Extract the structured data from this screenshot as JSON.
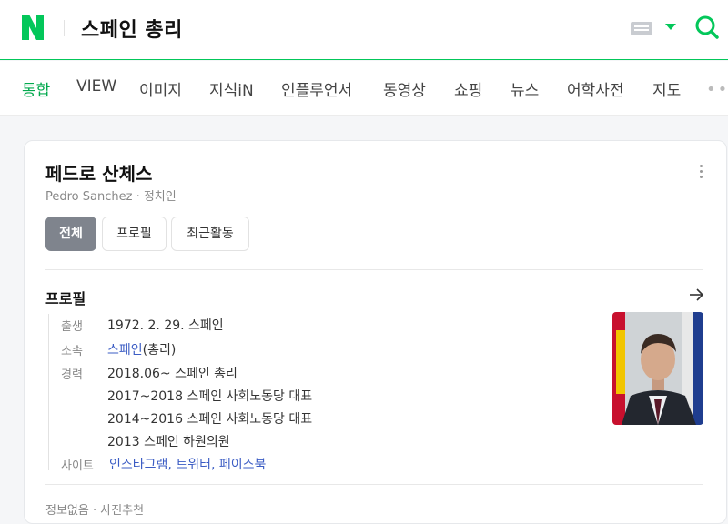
{
  "header": {
    "query": "스페인 총리"
  },
  "tabs": [
    {
      "label": "통합"
    },
    {
      "label": "VIEW"
    },
    {
      "label": "이미지"
    },
    {
      "label": "지식iN"
    },
    {
      "label": "인플루언서"
    },
    {
      "label": "동영상"
    },
    {
      "label": "쇼핑"
    },
    {
      "label": "뉴스"
    },
    {
      "label": "어학사전"
    },
    {
      "label": "지도"
    }
  ],
  "card": {
    "name": "페드로 산체스",
    "subtitle": "Pedro Sanchez · 정치인",
    "chips": [
      {
        "label": "전체"
      },
      {
        "label": "프로필"
      },
      {
        "label": "최근활동"
      }
    ],
    "section_title": "프로필",
    "profile": {
      "birth_label": "출생",
      "birth_value": "1972. 2. 29. 스페인",
      "affil_label": "소속",
      "affil_link": "스페인",
      "affil_rest": "(총리)",
      "career_label": "경력",
      "career": [
        "2018.06~ 스페인 총리",
        "2017~2018 스페인 사회노동당 대표",
        "2014~2016 스페인 사회노동당 대표",
        "2013 스페인 하원의원"
      ],
      "site_label": "사이트",
      "sites": [
        "인스타그램",
        "트위터",
        "페이스북"
      ]
    },
    "bottom_row": "정보없음 · 사진추천"
  },
  "colors": {
    "brand_green": "#03c75a",
    "link_blue": "#3b5cc4"
  }
}
